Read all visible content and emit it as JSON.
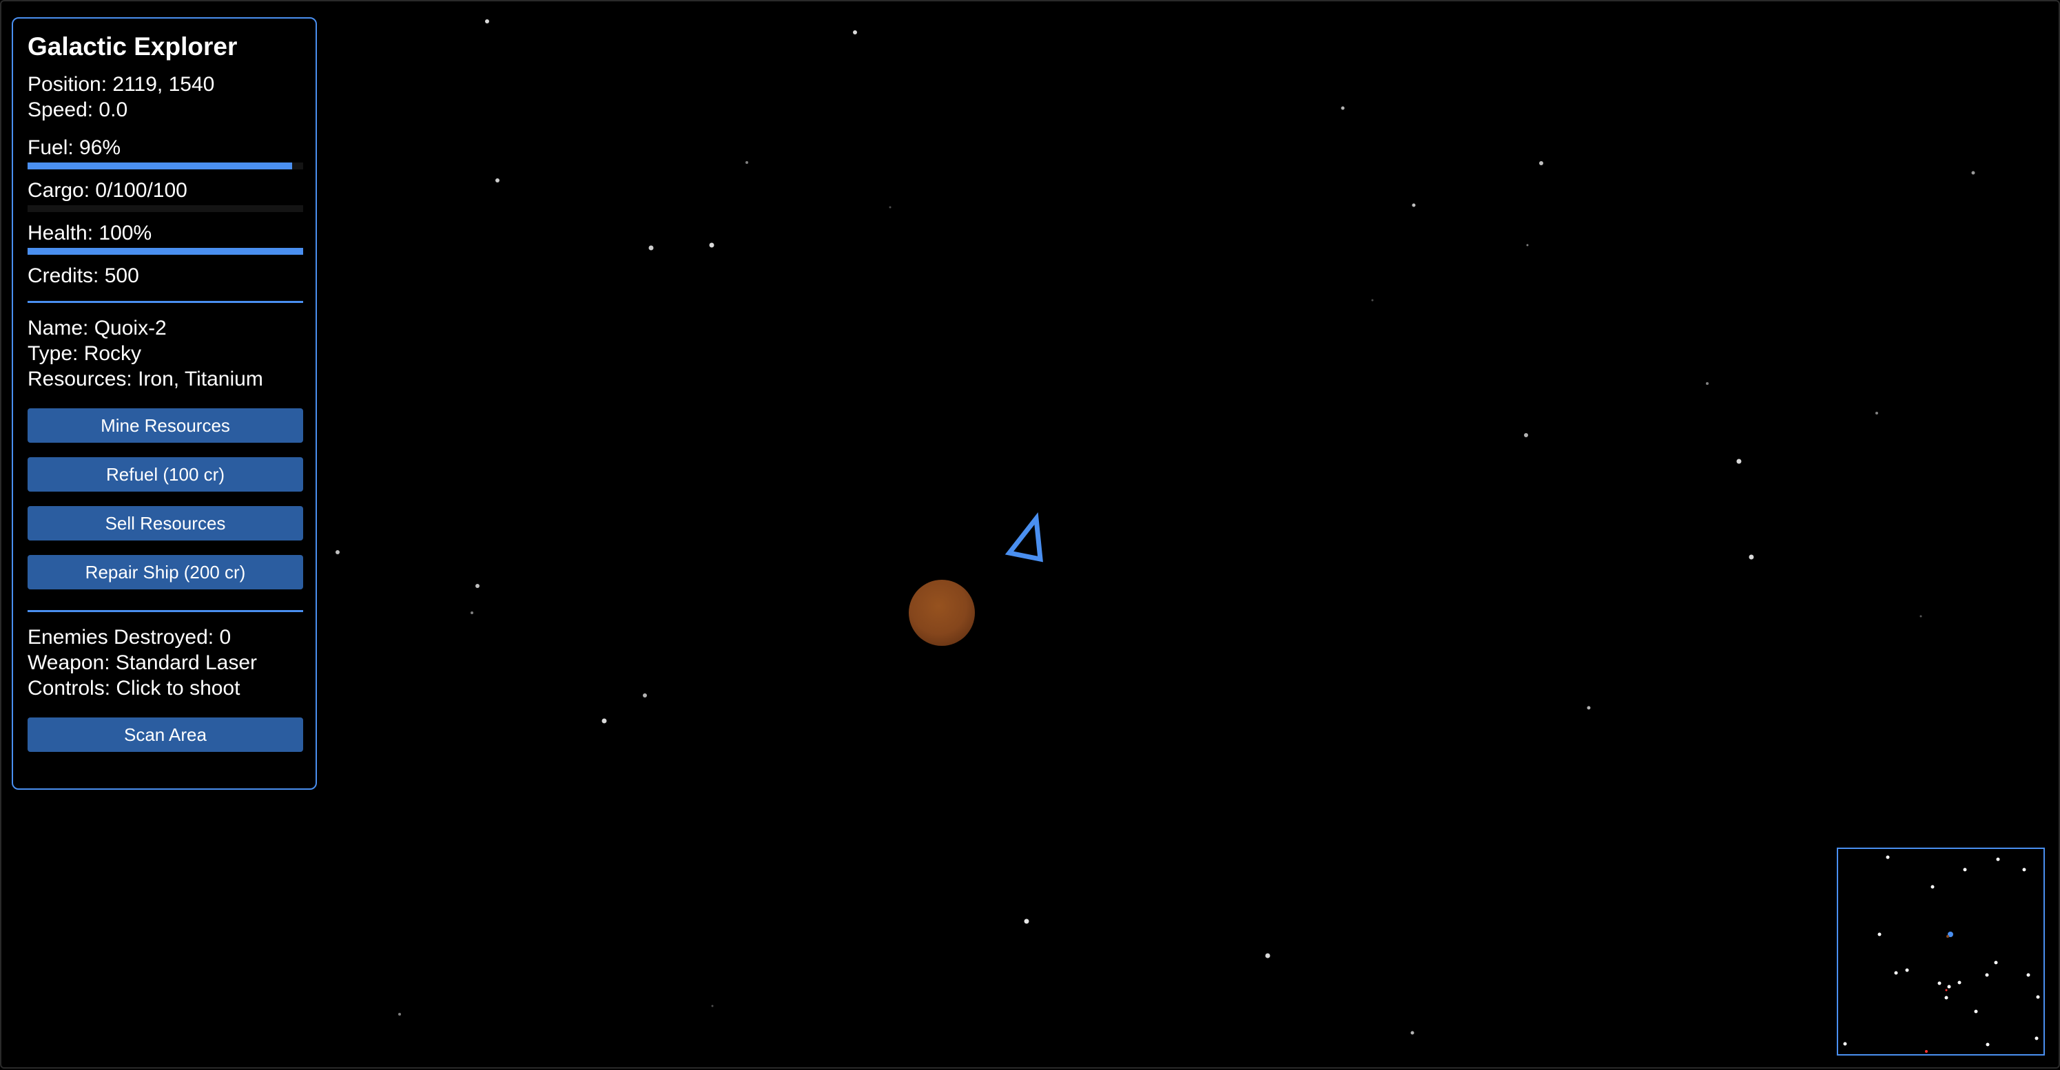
{
  "panel": {
    "title": "Galactic Explorer",
    "position": "Position: 2119, 1540",
    "speed": "Speed: 0.0",
    "fuel_label": "Fuel: 96%",
    "fuel_pct": 96,
    "cargo_label": "Cargo: 0/100/100",
    "cargo_pct": 0,
    "health_label": "Health: 100%",
    "health_pct": 100,
    "credits": "Credits: 500",
    "planet": {
      "name": "Name: Quoix-2",
      "type": "Type: Rocky",
      "resources": "Resources: Iron, Titanium"
    },
    "actions": {
      "mine": "Mine Resources",
      "refuel": "Refuel (100 cr)",
      "sell": "Sell Resources",
      "repair": "Repair Ship (200 cr)"
    },
    "combat": {
      "enemies": "Enemies Destroyed: 0",
      "weapon": "Weapon: Standard Laser",
      "controls": "Controls: Click to shoot"
    },
    "scan": "Scan Area"
  },
  "colors": {
    "accent": "#4a8ff0",
    "button": "#2b5da0",
    "planet": "#8a4a1e",
    "enemy_marker": "#ff3333"
  },
  "icons": {
    "ship": "triangle-outline-ship-icon",
    "planet": "planet-icon"
  }
}
